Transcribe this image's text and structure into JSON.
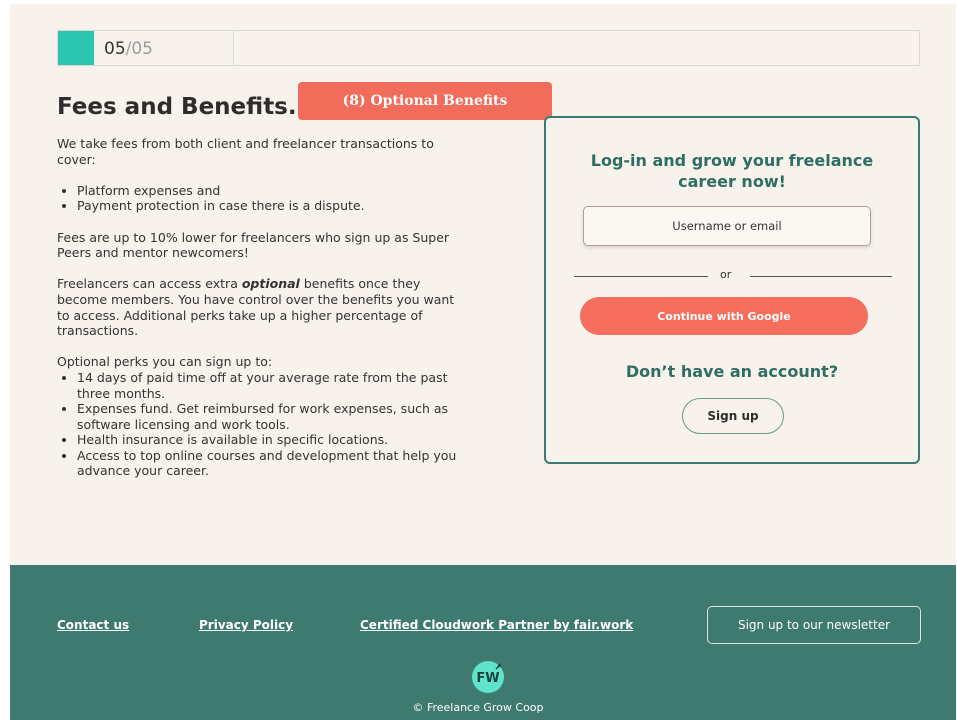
{
  "progress": {
    "current": "05",
    "total": "/05"
  },
  "page_title": "Fees and Benefits.",
  "annotation": "(8) Optional Benefits",
  "content": {
    "intro": "We take fees from both client and freelancer transactions to cover:",
    "cover_items": [
      "Platform expenses and",
      "Payment protection in case there is a dispute."
    ],
    "fees_note": "Fees are up to 10% lower for freelancers who sign up as Super Peers and mentor newcomers!",
    "benefits_pre": "Freelancers can access extra ",
    "benefits_emph": "optional",
    "benefits_post": " benefits once they become members. You have control over the benefits you want to access. Additional perks take up a higher percentage of transactions.",
    "perks_heading": "Optional perks you can sign up to:",
    "perks": [
      "14 days of paid time off at your average rate from the past three months.",
      "Expenses fund. Get reimbursed for work expenses, such as software licensing and work tools.",
      "Health insurance is available in specific locations.",
      "Access to top online courses and development that help you advance your career."
    ]
  },
  "login": {
    "heading_line1": "Log-in and grow your freelance",
    "heading_line2": "career now!",
    "username_placeholder": "Username or email",
    "or_label": "or",
    "google_label": "Continue with Google",
    "no_account": "Don’t have an account?",
    "signup_label": "Sign up"
  },
  "footer": {
    "contact": "Contact us",
    "privacy": "Privacy Policy",
    "certified": "Certified Cloudwork Partner by fair.work",
    "newsletter": "Sign up to our newsletter",
    "logo_text": "FW",
    "copyright": "© Freelance Grow Coop"
  },
  "colors": {
    "accent_teal": "#2cc5b0",
    "brand_green": "#3e7a70",
    "coral": "#f56d5d",
    "background": "#f7f2ec"
  }
}
